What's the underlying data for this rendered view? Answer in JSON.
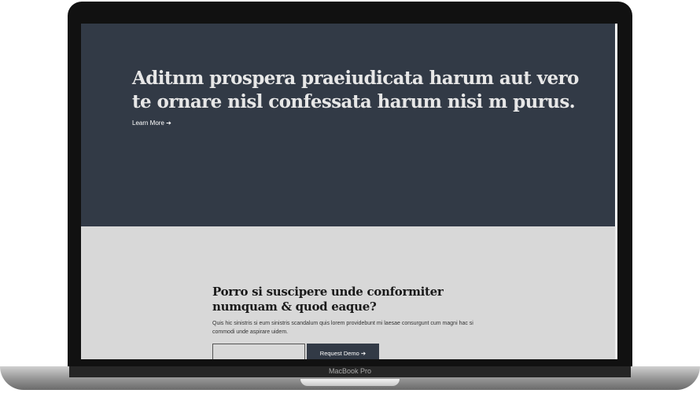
{
  "device": {
    "label": "MacBook Pro"
  },
  "hero": {
    "title": "Aditnm prospera praeiudicata harum aut vero te ornare nisl confessata harum nisi m purus.",
    "link_label": "Learn More ➔"
  },
  "cta": {
    "title": "Porro si suscipere unde conformiter numquam & quod eaque?",
    "description": "Quis hic sinistris si eum sinistris scandalum quis lorem providebunt mi laesae consurgunt cum magni hac si commodi unde aspirare uidem.",
    "input_value": "",
    "input_placeholder": "",
    "button_label": "Request Demo ➔"
  },
  "colors": {
    "hero_bg": "#323a46",
    "section_bg": "#d8d8d8",
    "button_bg": "#323a46"
  }
}
